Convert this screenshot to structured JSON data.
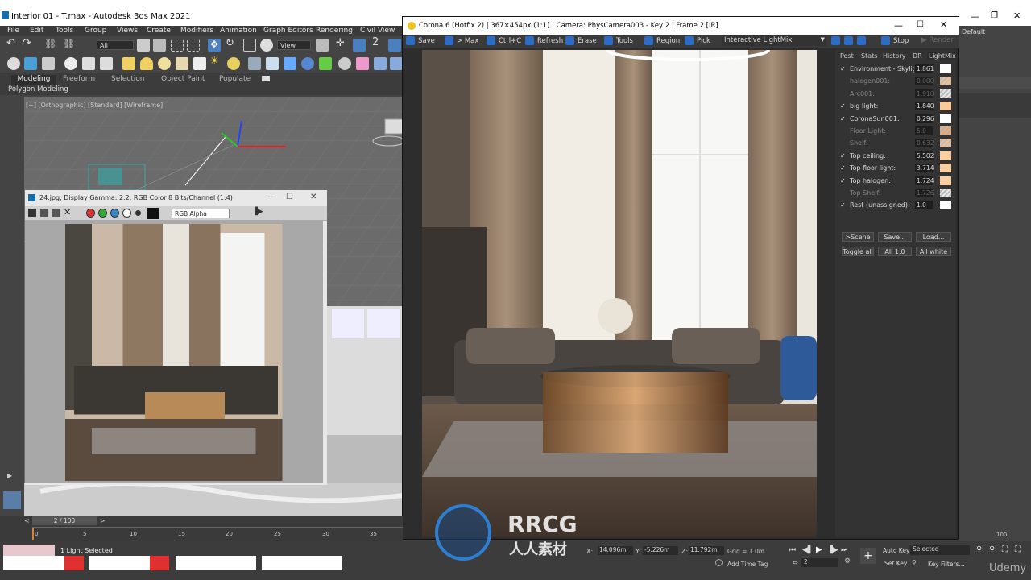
{
  "max_window": {
    "title": "Interior 01 - T.max - Autodesk 3ds Max 2021",
    "menu": [
      "File",
      "Edit",
      "Tools",
      "Group",
      "Views",
      "Create",
      "Modifiers",
      "Animation",
      "Graph Editors",
      "Rendering",
      "Civil View"
    ],
    "selection_filter": "All",
    "view_dropdown": "View",
    "ribbon_tabs": [
      "Modeling",
      "Freeform",
      "Selection",
      "Object Paint",
      "Populate"
    ],
    "ribbon_sub": "Polygon Modeling",
    "viewport_label": "[+] [Orthographic] [Standard] [Wireframe]",
    "workspace": "Default"
  },
  "frame_buffer_small": {
    "title": "24.jpg, Display Gamma: 2.2, RGB Color 8 Bits/Channel (1:4)",
    "channel": "RGB Alpha"
  },
  "corona": {
    "title": "Corona 6 (Hotfix 2) | 367×454px (1:1) | Camera: PhysCamera003 - Key 2 | Frame 2 [IR]",
    "toolbar": {
      "save": "Save",
      "max": "> Max",
      "copy": "Ctrl+C",
      "refresh": "Refresh",
      "erase": "Erase",
      "tools": "Tools",
      "region": "Region",
      "pick": "Pick",
      "mode": "Interactive LightMix",
      "stop": "Stop",
      "render": "Render"
    },
    "panel_tabs": [
      "Post",
      "Stats",
      "History",
      "DR",
      "LightMix"
    ],
    "lights": [
      {
        "name": "Environment - Skylight",
        "value": "1.861",
        "on": true,
        "swatch": "#ffffff",
        "hatched": false
      },
      {
        "name": "halogen001:",
        "value": "0.000",
        "on": false,
        "swatch": "#f7c08a",
        "hatched": true
      },
      {
        "name": "Arc001:",
        "value": "1.910",
        "on": false,
        "swatch": "#e8e8e8",
        "hatched": true
      },
      {
        "name": "big light:",
        "value": "1.840",
        "on": true,
        "swatch": "#fac99a",
        "hatched": false
      },
      {
        "name": "CoronaSun001:",
        "value": "0.296",
        "on": true,
        "swatch": "#ffffff",
        "hatched": false
      },
      {
        "name": "Floor Light:",
        "value": "5.0",
        "on": false,
        "swatch": "#f0a060",
        "hatched": true
      },
      {
        "name": "Shelf:",
        "value": "0.632",
        "on": false,
        "swatch": "#f7c08a",
        "hatched": true
      },
      {
        "name": "Top ceiling:",
        "value": "5.502",
        "on": true,
        "swatch": "#fccfa0",
        "hatched": false
      },
      {
        "name": "Top floor light:",
        "value": "3.714",
        "on": true,
        "swatch": "#fccfa0",
        "hatched": false
      },
      {
        "name": "Top halogen:",
        "value": "1.724",
        "on": true,
        "swatch": "#fccfa0",
        "hatched": false
      },
      {
        "name": "Top Shelf:",
        "value": "1.726",
        "on": false,
        "swatch": "#e8e8e8",
        "hatched": true
      },
      {
        "name": "Rest (unassigned):",
        "value": "1.0",
        "on": true,
        "swatch": "#ffffff",
        "hatched": false
      }
    ],
    "buttons_row1": [
      ">Scene",
      "Save...",
      "Load..."
    ],
    "buttons_row2": [
      "Toggle all",
      "All 1.0",
      "All white"
    ]
  },
  "timeline": {
    "frame": "2 / 100",
    "ticks": [
      "0",
      "5",
      "10",
      "15",
      "20",
      "25",
      "30",
      "35"
    ]
  },
  "status": {
    "selection": "1 Light Selected",
    "x": "14.096m",
    "y": "-5.226m",
    "z": "11.792m",
    "grid": "Grid = 1.0m",
    "add_time_tag": "Add Time Tag",
    "auto_key": "Auto Key",
    "set_key": "Set Key",
    "key_mode": "Selected",
    "key_filters": "Key Filters...",
    "frame_field": "2",
    "right_tick": "100"
  },
  "watermark": {
    "brand": "RRCG",
    "sub": "人人素材",
    "udemy": "Udemy"
  }
}
